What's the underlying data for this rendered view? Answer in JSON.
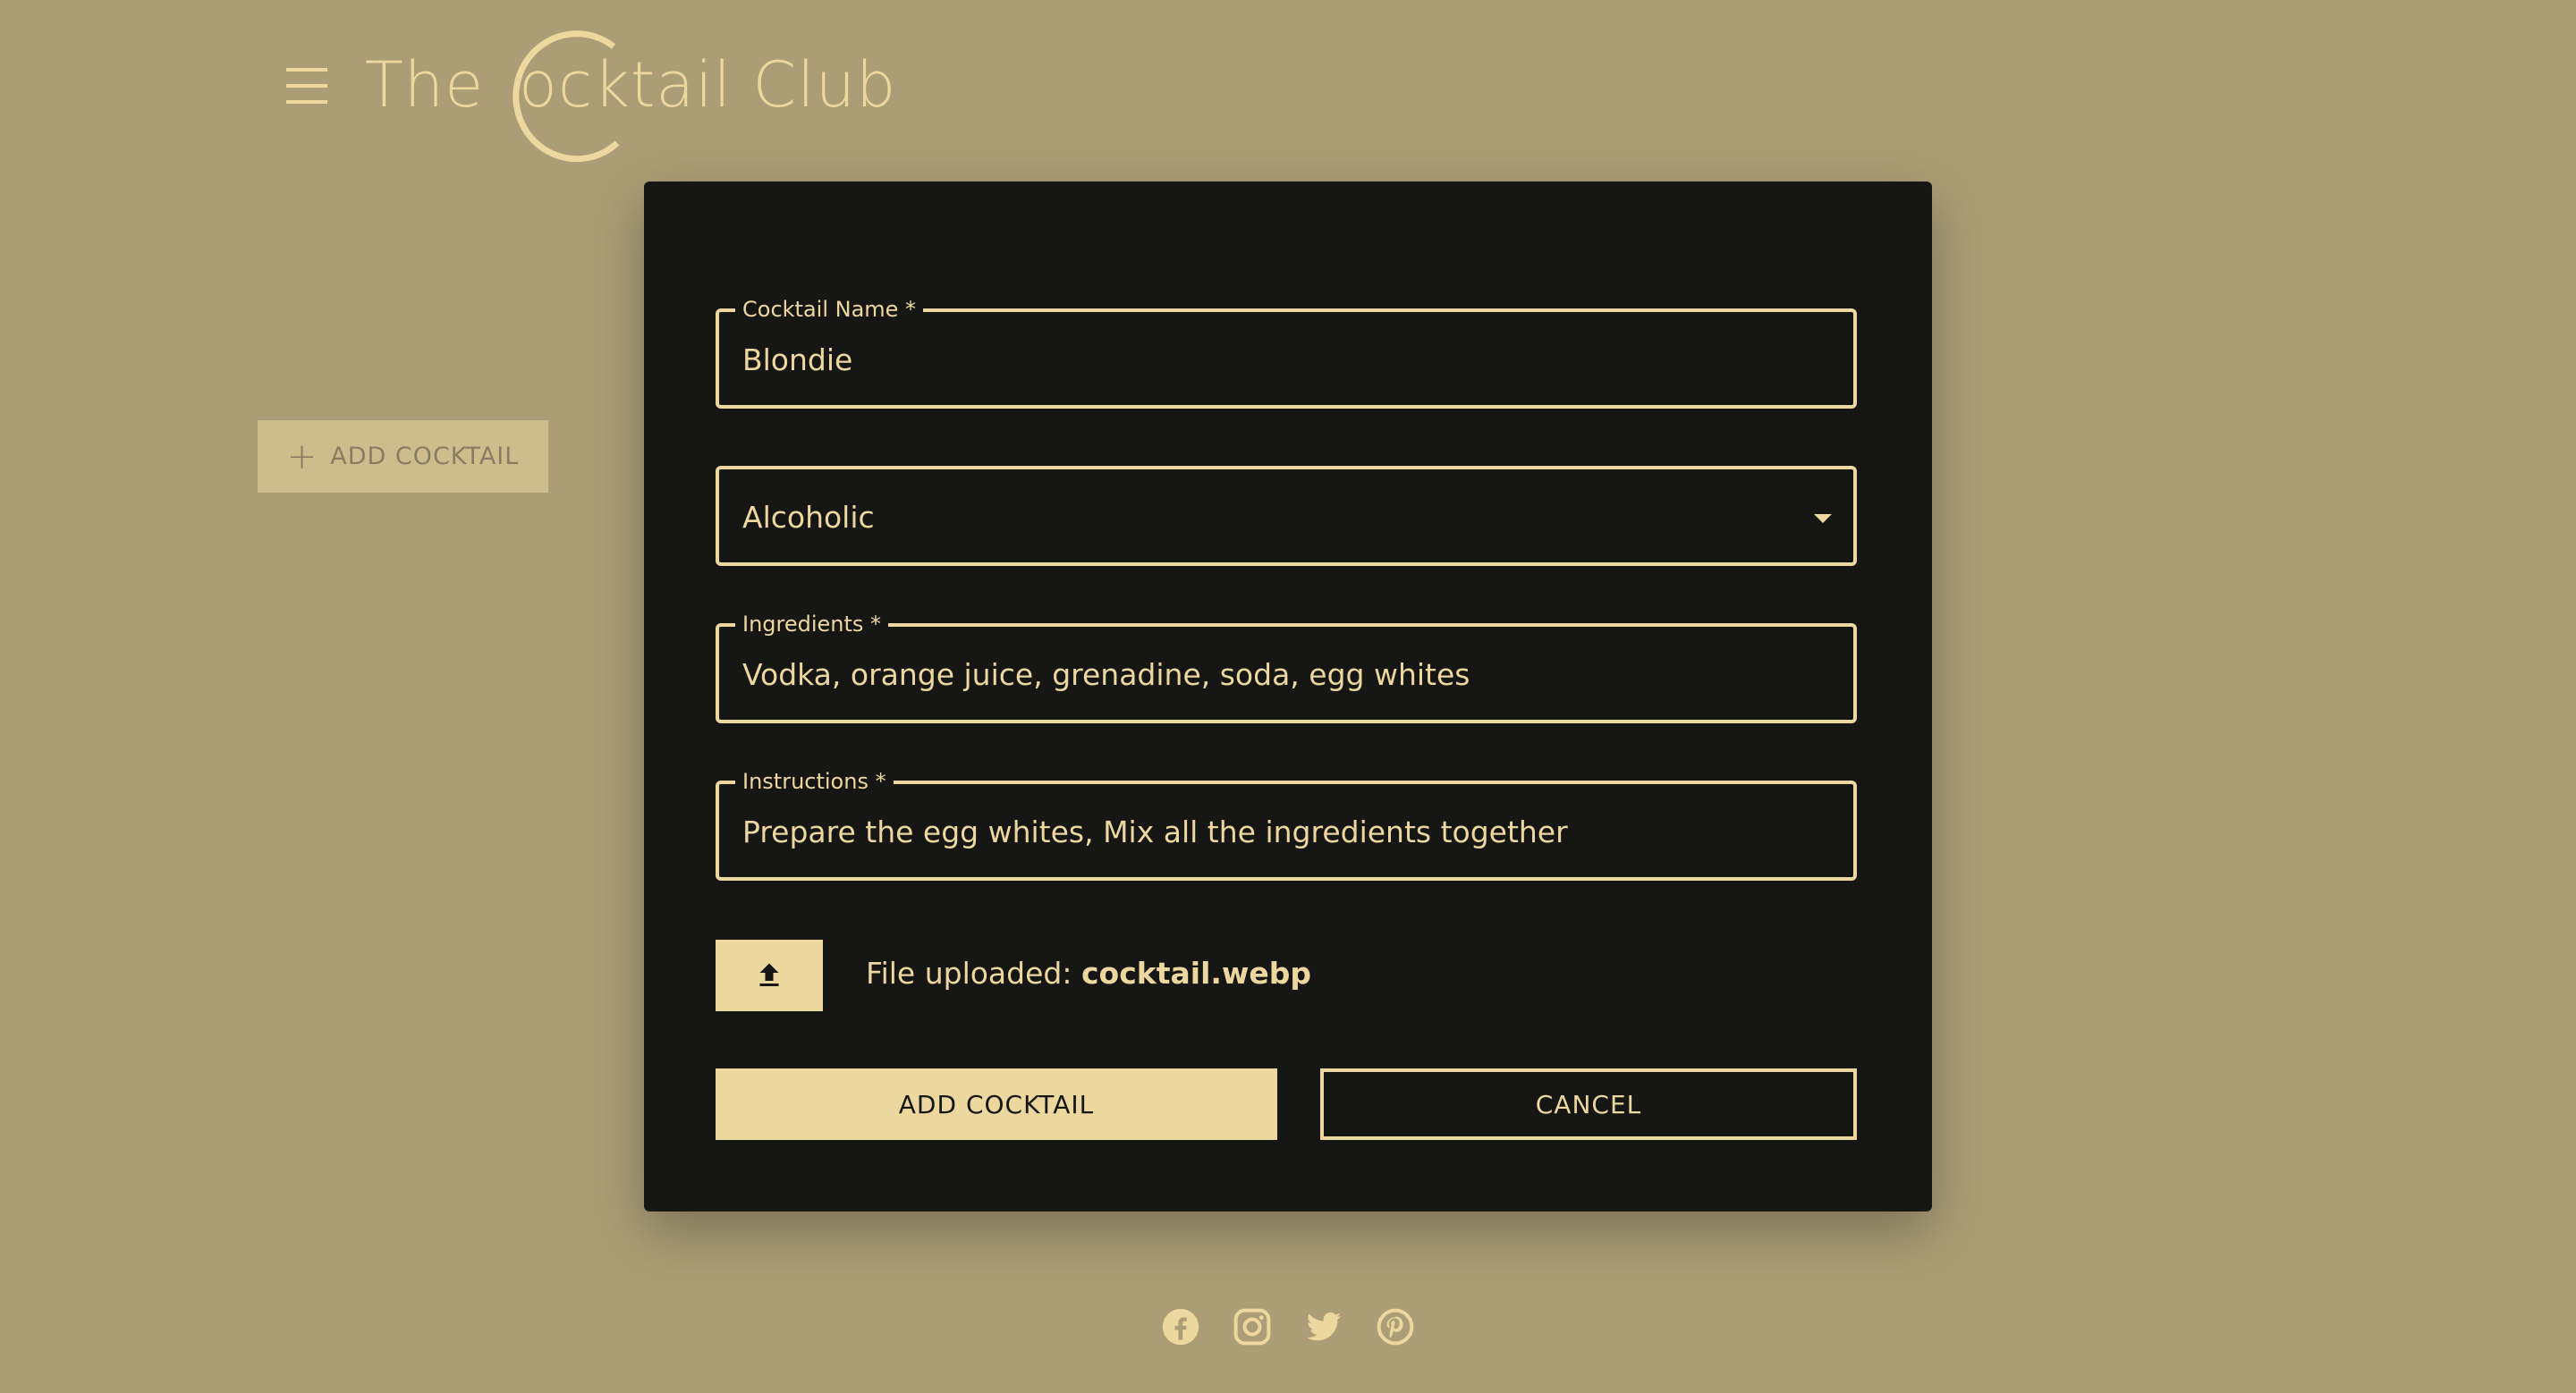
{
  "header": {
    "logo_prefix": "The",
    "logo_main": "ocktail Club",
    "logo_initial": "C"
  },
  "sidebar": {
    "add_button_label": "ADD COCKTAIL"
  },
  "form": {
    "name_label": "Cocktail Name *",
    "name_value": "Blondie",
    "category_value": "Alcoholic",
    "ingredients_label": "Ingredients *",
    "ingredients_value": "Vodka, orange juice, grenadine, soda, egg whites",
    "instructions_label": "Instructions *",
    "instructions_value": "Prepare the egg whites, Mix all the ingredients together",
    "upload_prefix": "File uploaded:",
    "upload_filename": "cocktail.webp",
    "submit_label": "ADD COCKTAIL",
    "cancel_label": "CANCEL"
  },
  "footer": {
    "social_icons": [
      "facebook-icon",
      "instagram-icon",
      "twitter-icon",
      "pinterest-icon"
    ]
  },
  "colors": {
    "page_background": "#ab9e76",
    "accent_gold": "#ecd79f",
    "modal_background": "#161614"
  }
}
